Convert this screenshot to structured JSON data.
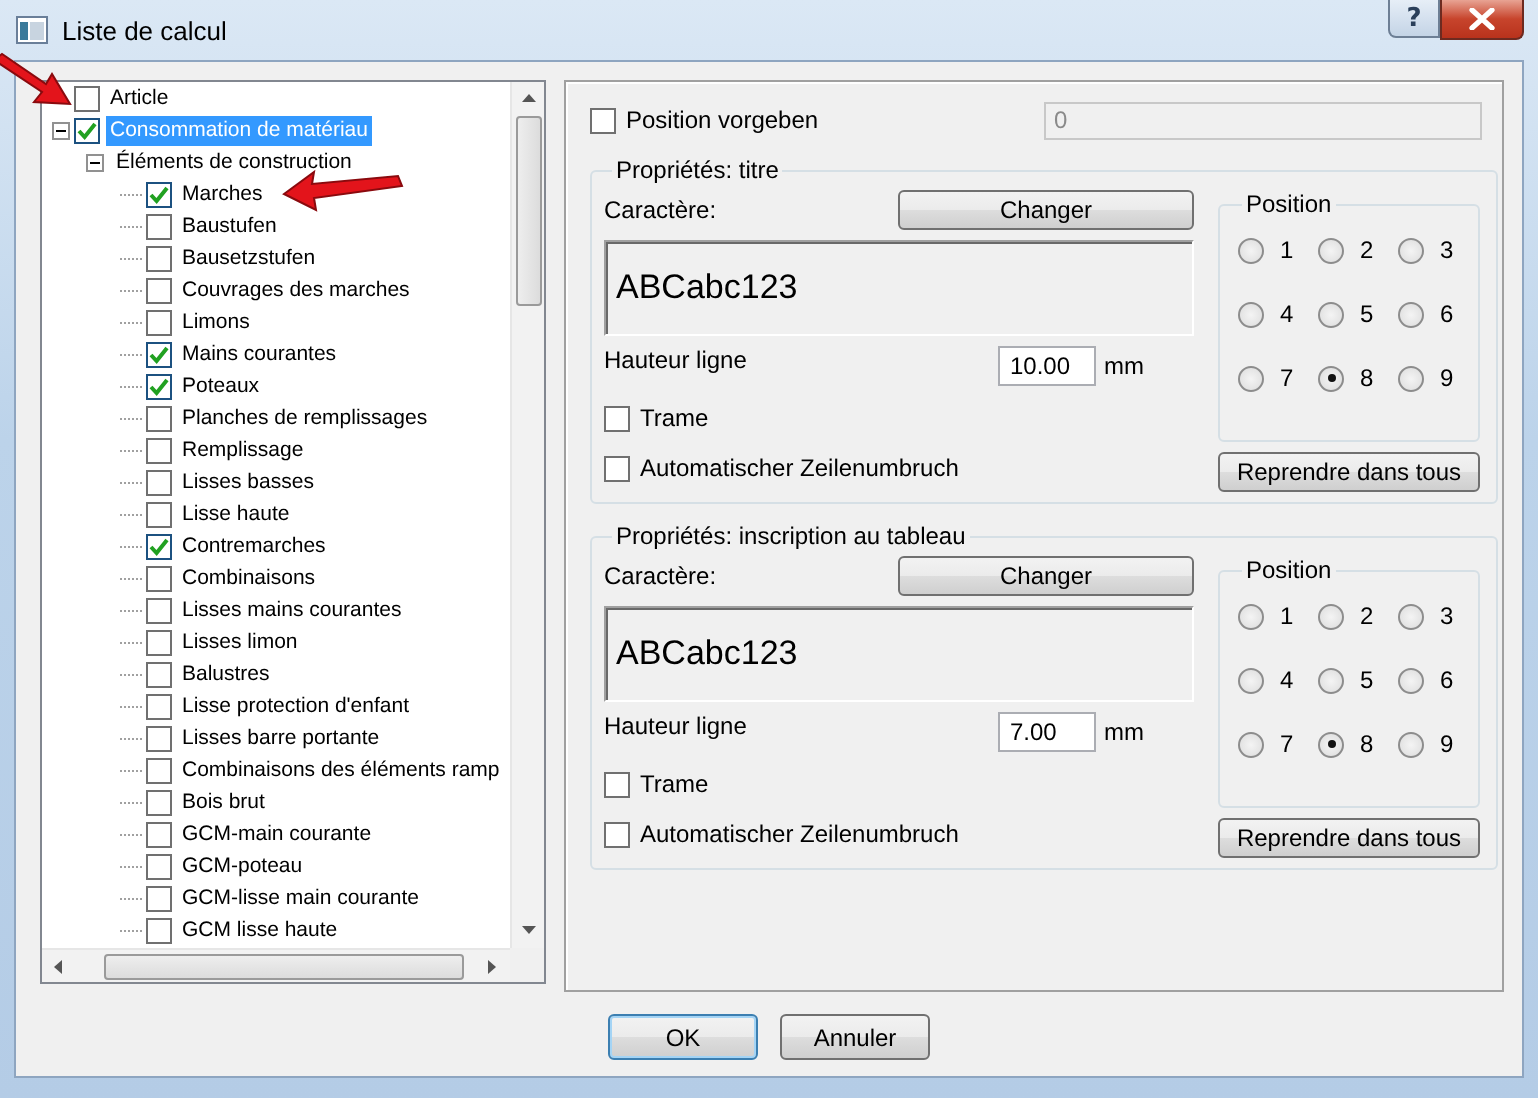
{
  "window": {
    "title": "Liste de calcul",
    "help_button": "?"
  },
  "tree": [
    {
      "label": "Article",
      "kind": "checkbox",
      "checked": false,
      "selected": false
    },
    {
      "label": "Consommation de matériau",
      "kind": "checkbox",
      "checked": true,
      "selected": true,
      "expanded": true,
      "children": [
        {
          "label": "Éléments de construction",
          "kind": "folder",
          "selected": false,
          "expanded": true,
          "children": [
            {
              "label": "Marches",
              "kind": "checkbox",
              "checked": true,
              "selected": false
            },
            {
              "label": "Baustufen",
              "kind": "checkbox",
              "checked": false,
              "selected": false
            },
            {
              "label": "Bausetzstufen",
              "kind": "checkbox",
              "checked": false,
              "selected": false
            },
            {
              "label": "Couvrages des marches",
              "kind": "checkbox",
              "checked": false,
              "selected": false
            },
            {
              "label": "Limons",
              "kind": "checkbox",
              "checked": false,
              "selected": false
            },
            {
              "label": "Mains courantes",
              "kind": "checkbox",
              "checked": true,
              "selected": false
            },
            {
              "label": "Poteaux",
              "kind": "checkbox",
              "checked": true,
              "selected": false
            },
            {
              "label": "Planches de remplissages",
              "kind": "checkbox",
              "checked": false,
              "selected": false
            },
            {
              "label": "Remplissage",
              "kind": "checkbox",
              "checked": false,
              "selected": false
            },
            {
              "label": "Lisses basses",
              "kind": "checkbox",
              "checked": false,
              "selected": false
            },
            {
              "label": "Lisse haute",
              "kind": "checkbox",
              "checked": false,
              "selected": false
            },
            {
              "label": "Contremarches",
              "kind": "checkbox",
              "checked": true,
              "selected": false
            },
            {
              "label": "Combinaisons",
              "kind": "checkbox",
              "checked": false,
              "selected": false
            },
            {
              "label": "Lisses mains courantes",
              "kind": "checkbox",
              "checked": false,
              "selected": false
            },
            {
              "label": "Lisses limon",
              "kind": "checkbox",
              "checked": false,
              "selected": false
            },
            {
              "label": "Balustres",
              "kind": "checkbox",
              "checked": false,
              "selected": false
            },
            {
              "label": "Lisse protection d'enfant",
              "kind": "checkbox",
              "checked": false,
              "selected": false
            },
            {
              "label": "Lisses barre portante",
              "kind": "checkbox",
              "checked": false,
              "selected": false
            },
            {
              "label": "Combinaisons des éléments ramp",
              "kind": "checkbox",
              "checked": false,
              "selected": false
            },
            {
              "label": "Bois brut",
              "kind": "checkbox",
              "checked": false,
              "selected": false
            },
            {
              "label": "GCM-main courante",
              "kind": "checkbox",
              "checked": false,
              "selected": false
            },
            {
              "label": "GCM-poteau",
              "kind": "checkbox",
              "checked": false,
              "selected": false
            },
            {
              "label": "GCM-lisse main courante",
              "kind": "checkbox",
              "checked": false,
              "selected": false
            },
            {
              "label": "GCM lisse haute",
              "kind": "checkbox",
              "checked": false,
              "selected": false
            }
          ]
        }
      ]
    }
  ],
  "position_vorgeben": {
    "label": "Position vorgeben",
    "checked": false,
    "value": "0",
    "disabled": true
  },
  "groups": [
    {
      "title": "Propriétés: titre",
      "font_label": "Caractère:",
      "change_button": "Changer",
      "preview": "ABCabc123",
      "height_label": "Hauteur ligne",
      "height_value": "10.00",
      "unit": "mm",
      "options": [
        {
          "label": "Trame",
          "checked": false
        },
        {
          "label": "Automatischer Zeilenumbruch",
          "checked": false
        }
      ],
      "position": {
        "title": "Position",
        "options": [
          {
            "label": "1",
            "selected": false
          },
          {
            "label": "2",
            "selected": false
          },
          {
            "label": "3",
            "selected": false
          },
          {
            "label": "4",
            "selected": false
          },
          {
            "label": "5",
            "selected": false
          },
          {
            "label": "6",
            "selected": false
          },
          {
            "label": "7",
            "selected": false
          },
          {
            "label": "8",
            "selected": true
          },
          {
            "label": "9",
            "selected": false
          }
        ]
      },
      "apply_button": "Reprendre dans tous"
    },
    {
      "title": "Propriétés: inscription au tableau",
      "font_label": "Caractère:",
      "change_button": "Changer",
      "preview": "ABCabc123",
      "height_label": "Hauteur ligne",
      "height_value": "7.00",
      "unit": "mm",
      "options": [
        {
          "label": "Trame",
          "checked": false
        },
        {
          "label": "Automatischer Zeilenumbruch",
          "checked": false
        }
      ],
      "position": {
        "title": "Position",
        "options": [
          {
            "label": "1",
            "selected": false
          },
          {
            "label": "2",
            "selected": false
          },
          {
            "label": "3",
            "selected": false
          },
          {
            "label": "4",
            "selected": false
          },
          {
            "label": "5",
            "selected": false
          },
          {
            "label": "6",
            "selected": false
          },
          {
            "label": "7",
            "selected": false
          },
          {
            "label": "8",
            "selected": true
          },
          {
            "label": "9",
            "selected": false
          }
        ]
      },
      "apply_button": "Reprendre dans tous"
    }
  ],
  "buttons": [
    {
      "label": "OK",
      "default": true
    },
    {
      "label": "Annuler",
      "default": false
    }
  ]
}
